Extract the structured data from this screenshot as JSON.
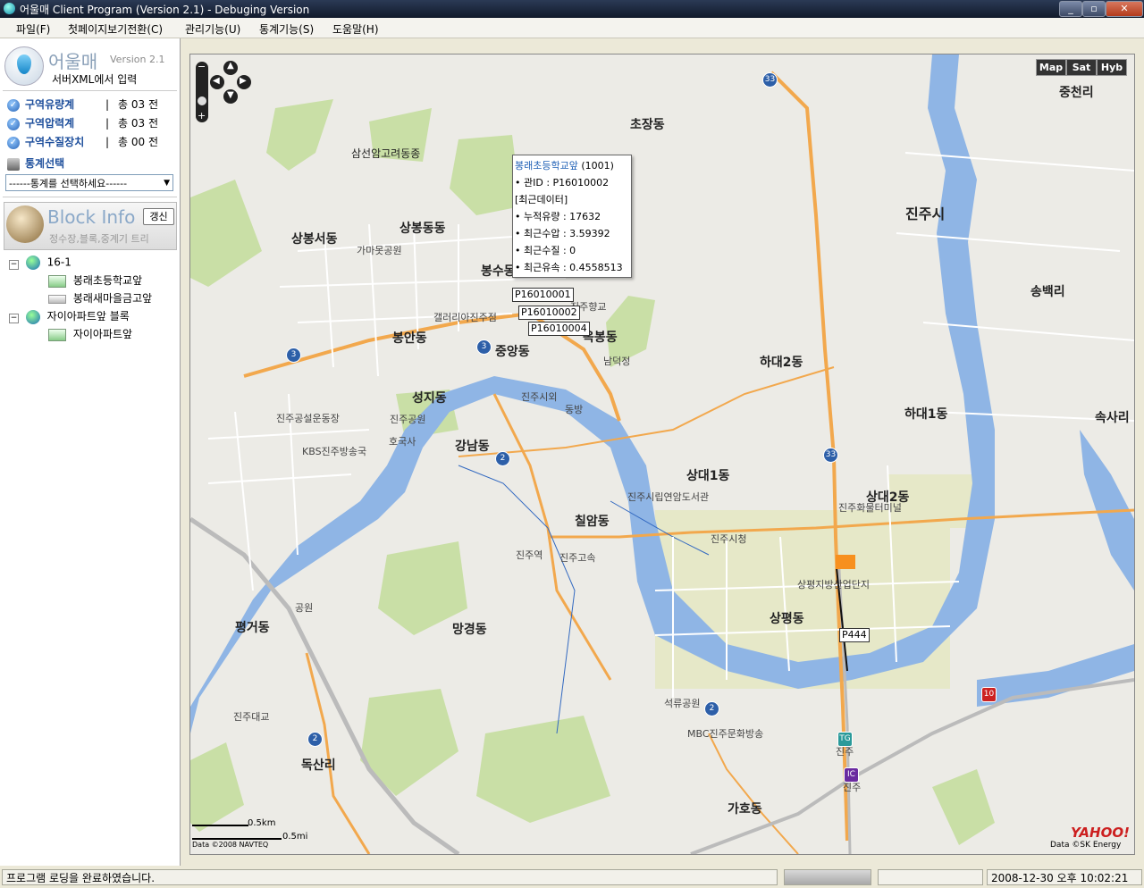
{
  "window": {
    "title": "어울매 Client Program (Version 2.1) - Debuging Version"
  },
  "menu": [
    "파일(F)",
    "첫페이지보기전환(C)",
    "관리기능(U)",
    "통계기능(S)",
    "도움말(H)"
  ],
  "app": {
    "name": "어울매",
    "version": "Version 2.1",
    "subtitle": "서버XML에서 입력"
  },
  "counts": [
    {
      "label": "구역유량계",
      "sep": "|",
      "value": "총 03 전"
    },
    {
      "label": "구역압력계",
      "sep": "|",
      "value": "총 03 전"
    },
    {
      "label": "구역수질장치",
      "sep": "|",
      "value": "총 00 전"
    }
  ],
  "stats": {
    "label": "통계선택",
    "select_value": "------통계를 선택하세요------"
  },
  "block_info": {
    "title": "Block Info",
    "refresh": "갱신",
    "subtitle": "정수장,블록,중계기 트리"
  },
  "tree": [
    {
      "label": "16-1",
      "level": 0
    },
    {
      "label": "봉래초등학교앞",
      "level": 1
    },
    {
      "label": "봉래새마을금고앞",
      "level": 1
    },
    {
      "label": "자이아파트앞 블록",
      "level": 0
    },
    {
      "label": "자이아파트앞",
      "level": 1
    }
  ],
  "map": {
    "types": [
      "Map",
      "Sat",
      "Hyb"
    ],
    "popup": {
      "title": "봉래초등학교앞",
      "id": "(1001)",
      "lines": [
        "• 관ID : P16010002",
        "[최근데이터]",
        "• 누적유량 : 17632",
        "• 최근수압 : 3.59392",
        "• 최근수질 : 0",
        "• 최근유속 : 0.4558513"
      ]
    },
    "tags": [
      "P16010001",
      "P16010002",
      "P16010004",
      "P444"
    ],
    "labels": [
      "초장동",
      "중천리",
      "삼선암고려동종",
      "진주시",
      "상봉동동",
      "상봉서동",
      "가마못공원",
      "봉수동",
      "송백리",
      "옥봉동",
      "진주향교",
      "갤러리아진주점",
      "봉안동",
      "중앙동",
      "남덕정",
      "하대2동",
      "하대1동",
      "속사리",
      "진주시외",
      "동방",
      "성지동",
      "진주공설운동장",
      "진주공원",
      "호국사",
      "강남동",
      "KBS진주방송국",
      "상대1동",
      "상대2동",
      "진주시립연암도서관",
      "진주화물터미널",
      "칠암동",
      "진주시청",
      "진주역",
      "진주고속",
      "상평지방산업단지",
      "공원",
      "평거동",
      "망경동",
      "상평동",
      "석류공원",
      "진주대교",
      "MBC진주문화방송",
      "독산리",
      "가호동",
      "진주",
      "진주"
    ],
    "roads": [
      "33",
      "3",
      "3",
      "2",
      "2",
      "2",
      "33",
      "10",
      "TG",
      "IC"
    ],
    "scale": {
      "km": "0.5km",
      "mi": "0.5mi"
    },
    "copyright_left": "Data ©2008 NAVTEQ",
    "copyright_right": "Data ©SK Energy",
    "logo": "YAHOO!"
  },
  "status": {
    "message": "프로그램 로딩을 완료하였습니다.",
    "datetime": "2008-12-30 오후 10:02:21"
  }
}
